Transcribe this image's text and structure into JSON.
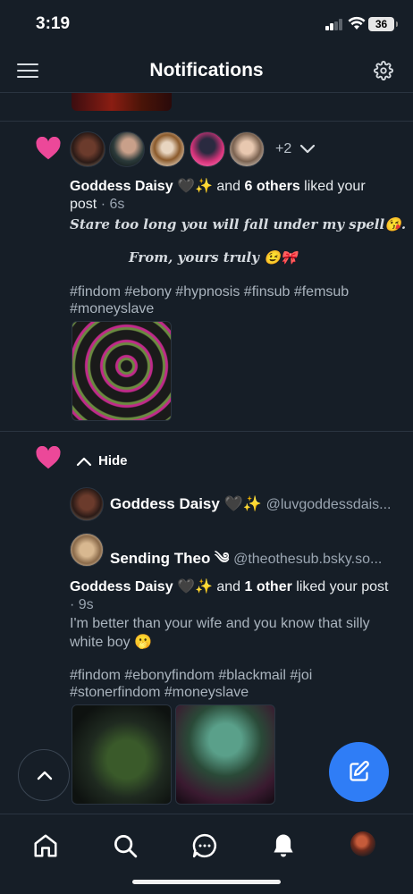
{
  "status_bar": {
    "time": "3:19",
    "battery": "36"
  },
  "header": {
    "title": "Notifications"
  },
  "notification1": {
    "extra_count": "+2",
    "actor": "Goddess Daisy 🖤✨",
    "connector": " and ",
    "others": "6 others",
    "action": " liked your",
    "line2_word": "post",
    "time": " · 6s",
    "post_line1": "Stare too long you will fall under my spell😘.",
    "post_line2": "From, yours truly 😉🎀",
    "tags_line1": "#findom #ebony #hypnosis #finsub #femsub",
    "tags_line2": "#moneyslave"
  },
  "notification2": {
    "hide_label": "Hide",
    "user1_name": "Goddess Daisy 🖤✨",
    "user1_handle": "@luvgoddessdais...",
    "user2_name": "Sending Theo ༄",
    "user2_handle": "@theothesub.bsky.so...",
    "actor": "Goddess Daisy 🖤✨",
    "connector": " and ",
    "others": "1 other",
    "action": " liked your post",
    "time": "· 9s",
    "post_line1": "I'm better than your wife and you know that silly",
    "post_line2": "white boy 🫢",
    "tags_line1": "#findom #ebonyfindom #blackmail #joi",
    "tags_line2": "#stonerfindom #moneyslave"
  },
  "colors": {
    "background": "#161e27",
    "heart": "#ec4899",
    "accent": "#2f7df6",
    "divider": "#2a3440"
  },
  "icons": [
    "menu-icon",
    "gear-icon",
    "heart-icon",
    "chevron-down-icon",
    "chevron-up-icon",
    "pencil-square-icon",
    "home-icon",
    "search-icon",
    "chat-icon",
    "bell-icon"
  ]
}
